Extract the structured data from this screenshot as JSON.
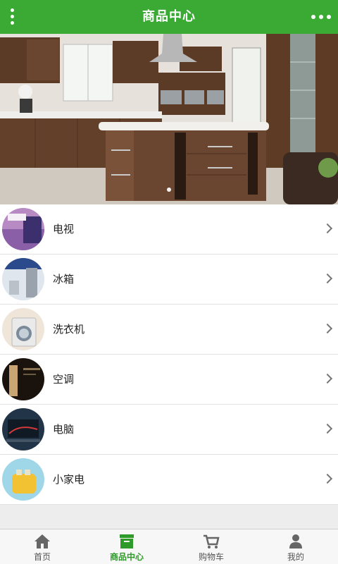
{
  "header": {
    "title": "商品中心"
  },
  "categories": [
    {
      "label": "电视"
    },
    {
      "label": "冰箱"
    },
    {
      "label": "洗衣机"
    },
    {
      "label": "空调"
    },
    {
      "label": "电脑"
    },
    {
      "label": "小家电"
    }
  ],
  "tabs": [
    {
      "label": "首页",
      "icon": "home-icon"
    },
    {
      "label": "商品中心",
      "icon": "box-icon"
    },
    {
      "label": "购物车",
      "icon": "cart-icon"
    },
    {
      "label": "我的",
      "icon": "person-icon"
    }
  ],
  "colors": {
    "accent": "#3aaa35",
    "active_tab": "#2e9a2a"
  }
}
